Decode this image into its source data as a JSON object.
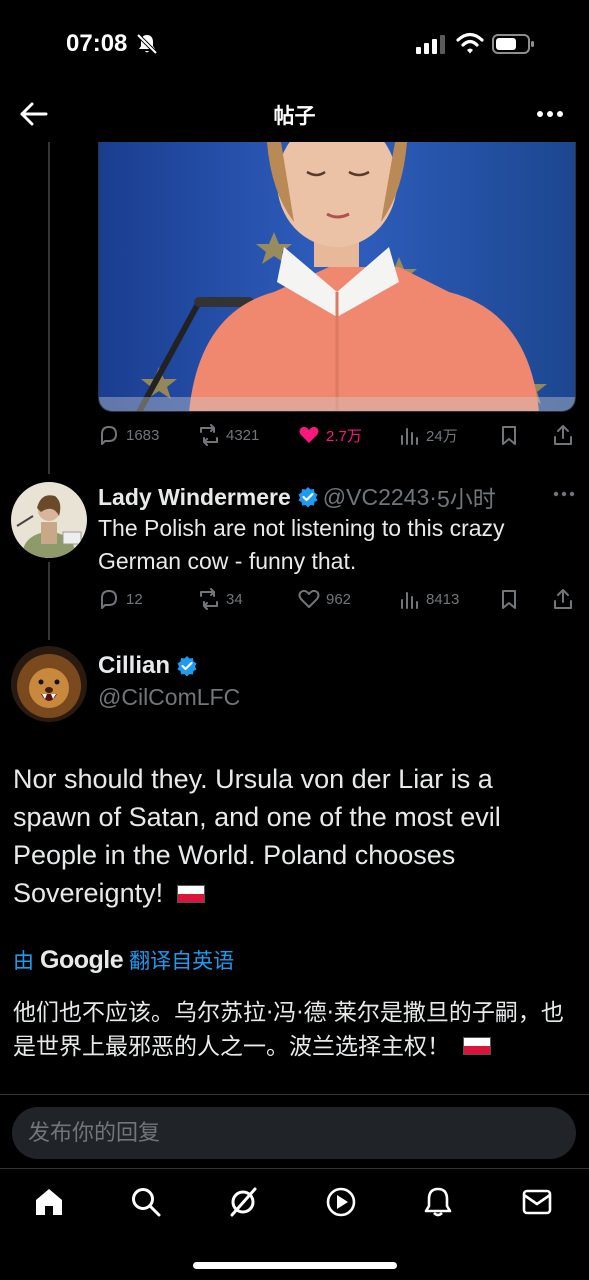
{
  "status_bar": {
    "time": "07:08"
  },
  "header": {
    "title": "帖子"
  },
  "quoted_post": {
    "stats": {
      "replies": "1683",
      "reposts": "4321",
      "likes": "2.7万",
      "views": "24万"
    }
  },
  "reply": {
    "name": "Lady Windermere",
    "handle": "@VC2243",
    "dot": "·",
    "time": "5小时",
    "text": "The Polish are not listening to this crazy German cow - funny that.",
    "stats": {
      "replies": "12",
      "reposts": "34",
      "likes": "962",
      "views": "8413"
    }
  },
  "main_post": {
    "name": "Cillian",
    "handle": "@CilComLFC",
    "text": "Nor should they. Ursula von der Liar is a spawn of Satan, and one of the most evil People in the World. Poland chooses Sovereignty!",
    "translation": {
      "by": "由",
      "provider": "Google",
      "label": "翻译自英语",
      "text": "他们也不应该。乌尔苏拉·冯·德·莱尔是撒旦的子嗣，也是世界上最邪恶的人之一。波兰选择主权！"
    }
  },
  "composer": {
    "placeholder": "发布你的回复"
  },
  "colors": {
    "accent": "#1d9bf0",
    "like": "#f91880",
    "muted": "#71767b",
    "background": "#000000"
  },
  "icons": [
    "back-arrow-icon",
    "more-icon",
    "reply-icon",
    "repost-icon",
    "heart-icon",
    "views-icon",
    "bookmark-icon",
    "share-icon",
    "verified-icon",
    "home-icon",
    "search-icon",
    "grok-icon",
    "video-icon",
    "notifications-icon",
    "messages-icon"
  ]
}
